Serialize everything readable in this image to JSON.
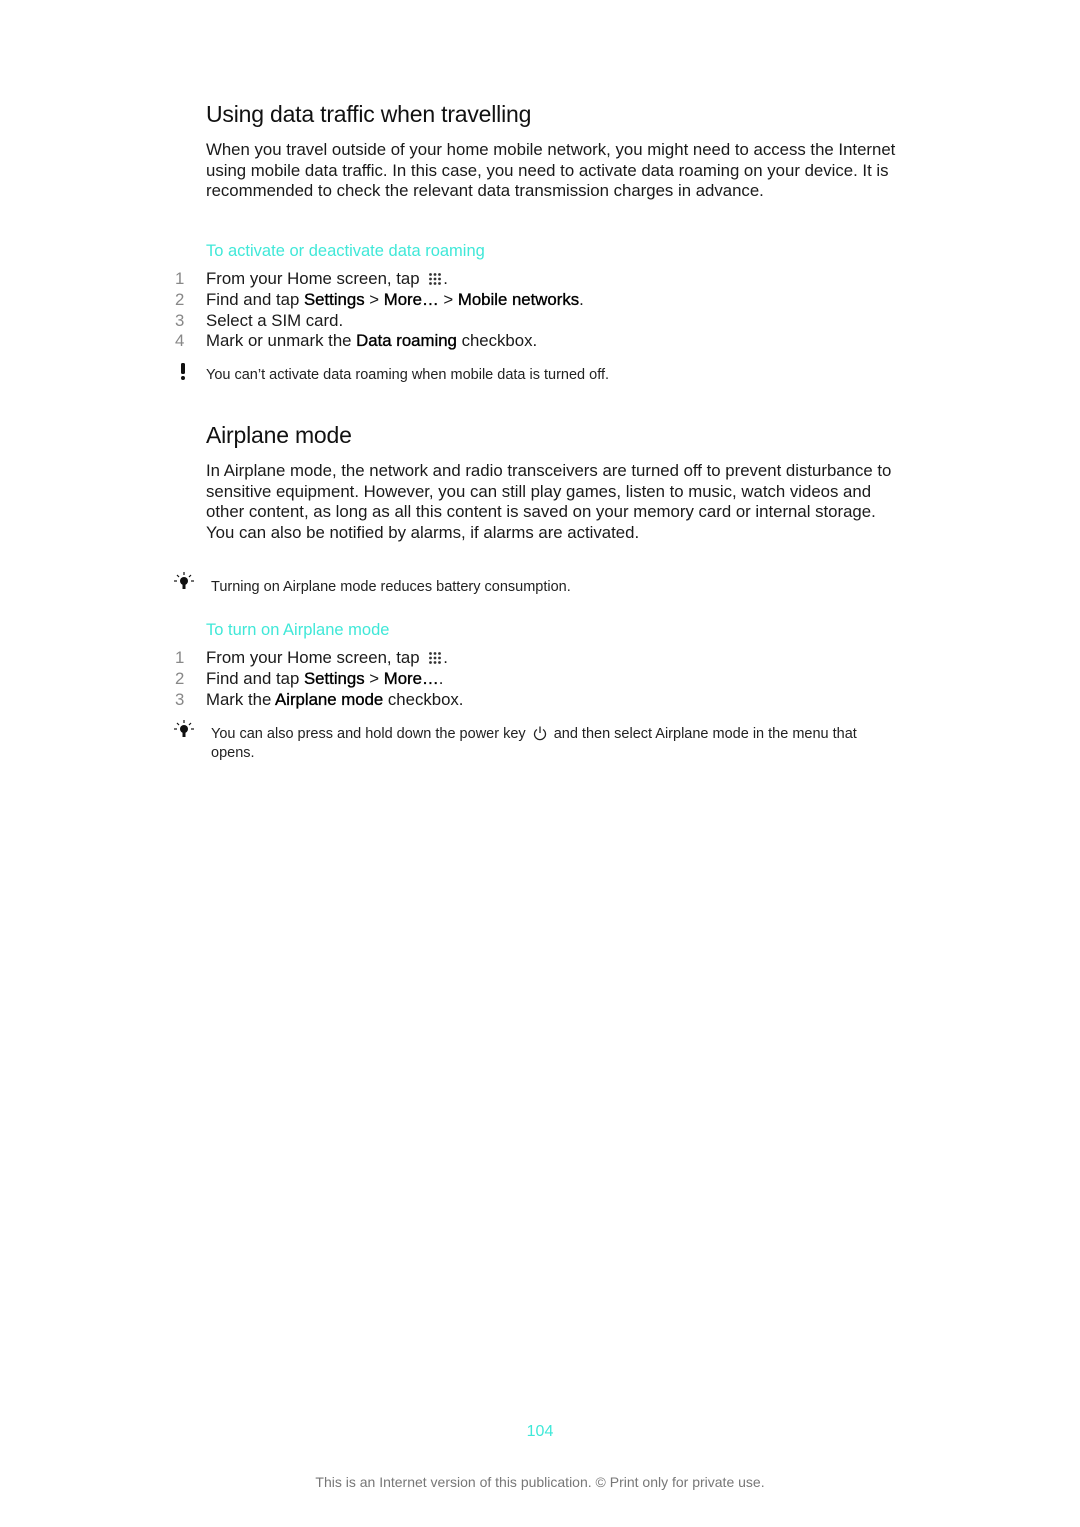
{
  "section1": {
    "title": "Using data traffic when travelling",
    "body": "When you travel outside of your home mobile network, you might need to access the Internet using mobile data traffic. In this case, you need to activate data roaming on your device. It is recommended to check the relevant data transmission charges in advance.",
    "procedure_title": "To activate or deactivate data roaming",
    "steps": [
      {
        "num": "1",
        "pre": "From your Home screen, tap ",
        "icon": "apps-grid-icon",
        "post": "."
      },
      {
        "num": "2",
        "pre": "Find and tap ",
        "b1": "Settings",
        "sep1": " > ",
        "b2": "More…",
        "sep2": " > ",
        "b3": "Mobile networks",
        "post": "."
      },
      {
        "num": "3",
        "pre": "Select a SIM card."
      },
      {
        "num": "4",
        "pre": "Mark or unmark the ",
        "b1": "Data roaming",
        "post": " checkbox."
      }
    ],
    "warning": {
      "icon": "exclamation-icon",
      "text": "You can’t activate data roaming when mobile data is turned off."
    }
  },
  "section2": {
    "title": "Airplane mode",
    "body": "In Airplane mode, the network and radio transceivers are turned off to prevent disturbance to sensitive equipment. However, you can still play games, listen to music, watch videos and other content, as long as all this content is saved on your memory card or internal storage. You can also be notified by alarms, if alarms are activated.",
    "tip1": {
      "icon": "lightbulb-icon",
      "text": "Turning on Airplane mode reduces battery consumption."
    },
    "procedure_title": "To turn on Airplane mode",
    "steps": [
      {
        "num": "1",
        "pre": "From your Home screen, tap ",
        "icon": "apps-grid-icon",
        "post": "."
      },
      {
        "num": "2",
        "pre": "Find and tap ",
        "b1": "Settings",
        "sep1": " > ",
        "b2": "More…",
        "post": "."
      },
      {
        "num": "3",
        "pre": "Mark the ",
        "b1": "Airplane mode",
        "post": " checkbox."
      }
    ],
    "tip2": {
      "icon": "lightbulb-icon",
      "pre": "You can also press and hold down the power key ",
      "post": " and then select Airplane mode in the menu that opens."
    }
  },
  "page_number": "104",
  "footer": "This is an Internet version of this publication. © Print only for private use.",
  "colors": {
    "accent": "#40e8d8",
    "text": "#1a1a1a",
    "step_number": "#888888",
    "footer": "#777777"
  }
}
